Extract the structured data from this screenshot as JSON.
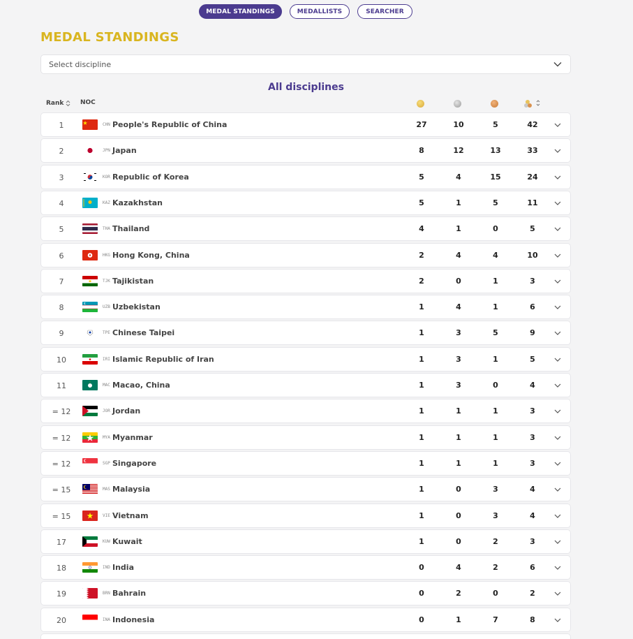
{
  "tabs": [
    {
      "label": "MEDAL STANDINGS",
      "active": true
    },
    {
      "label": "MEDALLISTS",
      "active": false
    },
    {
      "label": "SEARCHER",
      "active": false
    }
  ],
  "page_title": "MEDAL STANDINGS",
  "discipline_select": {
    "placeholder": "Select discipline"
  },
  "table_title": "All disciplines",
  "table_header": {
    "rank": "Rank",
    "noc": "NOC"
  },
  "icons": {
    "gold": "gold-medal-icon",
    "silver": "silver-medal-icon",
    "bronze": "bronze-medal-icon",
    "total": "total-medals-icon",
    "sort": "sort-icon",
    "expand": "chevron-down-icon"
  },
  "rows": [
    {
      "rank": "1",
      "code": "CHN",
      "name": "People's Republic of China",
      "gold": "27",
      "silver": "10",
      "bronze": "5",
      "total": "42"
    },
    {
      "rank": "2",
      "code": "JPN",
      "name": "Japan",
      "gold": "8",
      "silver": "12",
      "bronze": "13",
      "total": "33"
    },
    {
      "rank": "3",
      "code": "KOR",
      "name": "Republic of Korea",
      "gold": "5",
      "silver": "4",
      "bronze": "15",
      "total": "24"
    },
    {
      "rank": "4",
      "code": "KAZ",
      "name": "Kazakhstan",
      "gold": "5",
      "silver": "1",
      "bronze": "5",
      "total": "11"
    },
    {
      "rank": "5",
      "code": "THA",
      "name": "Thailand",
      "gold": "4",
      "silver": "1",
      "bronze": "0",
      "total": "5"
    },
    {
      "rank": "6",
      "code": "HKG",
      "name": "Hong Kong, China",
      "gold": "2",
      "silver": "4",
      "bronze": "4",
      "total": "10"
    },
    {
      "rank": "7",
      "code": "TJK",
      "name": "Tajikistan",
      "gold": "2",
      "silver": "0",
      "bronze": "1",
      "total": "3"
    },
    {
      "rank": "8",
      "code": "UZB",
      "name": "Uzbekistan",
      "gold": "1",
      "silver": "4",
      "bronze": "1",
      "total": "6"
    },
    {
      "rank": "9",
      "code": "TPE",
      "name": "Chinese Taipei",
      "gold": "1",
      "silver": "3",
      "bronze": "5",
      "total": "9"
    },
    {
      "rank": "10",
      "code": "IRI",
      "name": "Islamic Republic of Iran",
      "gold": "1",
      "silver": "3",
      "bronze": "1",
      "total": "5"
    },
    {
      "rank": "11",
      "code": "MAC",
      "name": "Macao, China",
      "gold": "1",
      "silver": "3",
      "bronze": "0",
      "total": "4"
    },
    {
      "rank": "= 12",
      "code": "JOR",
      "name": "Jordan",
      "gold": "1",
      "silver": "1",
      "bronze": "1",
      "total": "3"
    },
    {
      "rank": "= 12",
      "code": "MYA",
      "name": "Myanmar",
      "gold": "1",
      "silver": "1",
      "bronze": "1",
      "total": "3"
    },
    {
      "rank": "= 12",
      "code": "SGP",
      "name": "Singapore",
      "gold": "1",
      "silver": "1",
      "bronze": "1",
      "total": "3"
    },
    {
      "rank": "= 15",
      "code": "MAS",
      "name": "Malaysia",
      "gold": "1",
      "silver": "0",
      "bronze": "3",
      "total": "4"
    },
    {
      "rank": "= 15",
      "code": "VIE",
      "name": "Vietnam",
      "gold": "1",
      "silver": "0",
      "bronze": "3",
      "total": "4"
    },
    {
      "rank": "17",
      "code": "KUW",
      "name": "Kuwait",
      "gold": "1",
      "silver": "0",
      "bronze": "2",
      "total": "3"
    },
    {
      "rank": "18",
      "code": "IND",
      "name": "India",
      "gold": "0",
      "silver": "4",
      "bronze": "2",
      "total": "6"
    },
    {
      "rank": "19",
      "code": "BRN",
      "name": "Bahrain",
      "gold": "0",
      "silver": "2",
      "bronze": "0",
      "total": "2"
    },
    {
      "rank": "20",
      "code": "INA",
      "name": "Indonesia",
      "gold": "0",
      "silver": "1",
      "bronze": "7",
      "total": "8"
    },
    {
      "rank": "",
      "code": "",
      "name": "",
      "gold": "",
      "silver": "",
      "bronze": "",
      "total": ""
    }
  ]
}
